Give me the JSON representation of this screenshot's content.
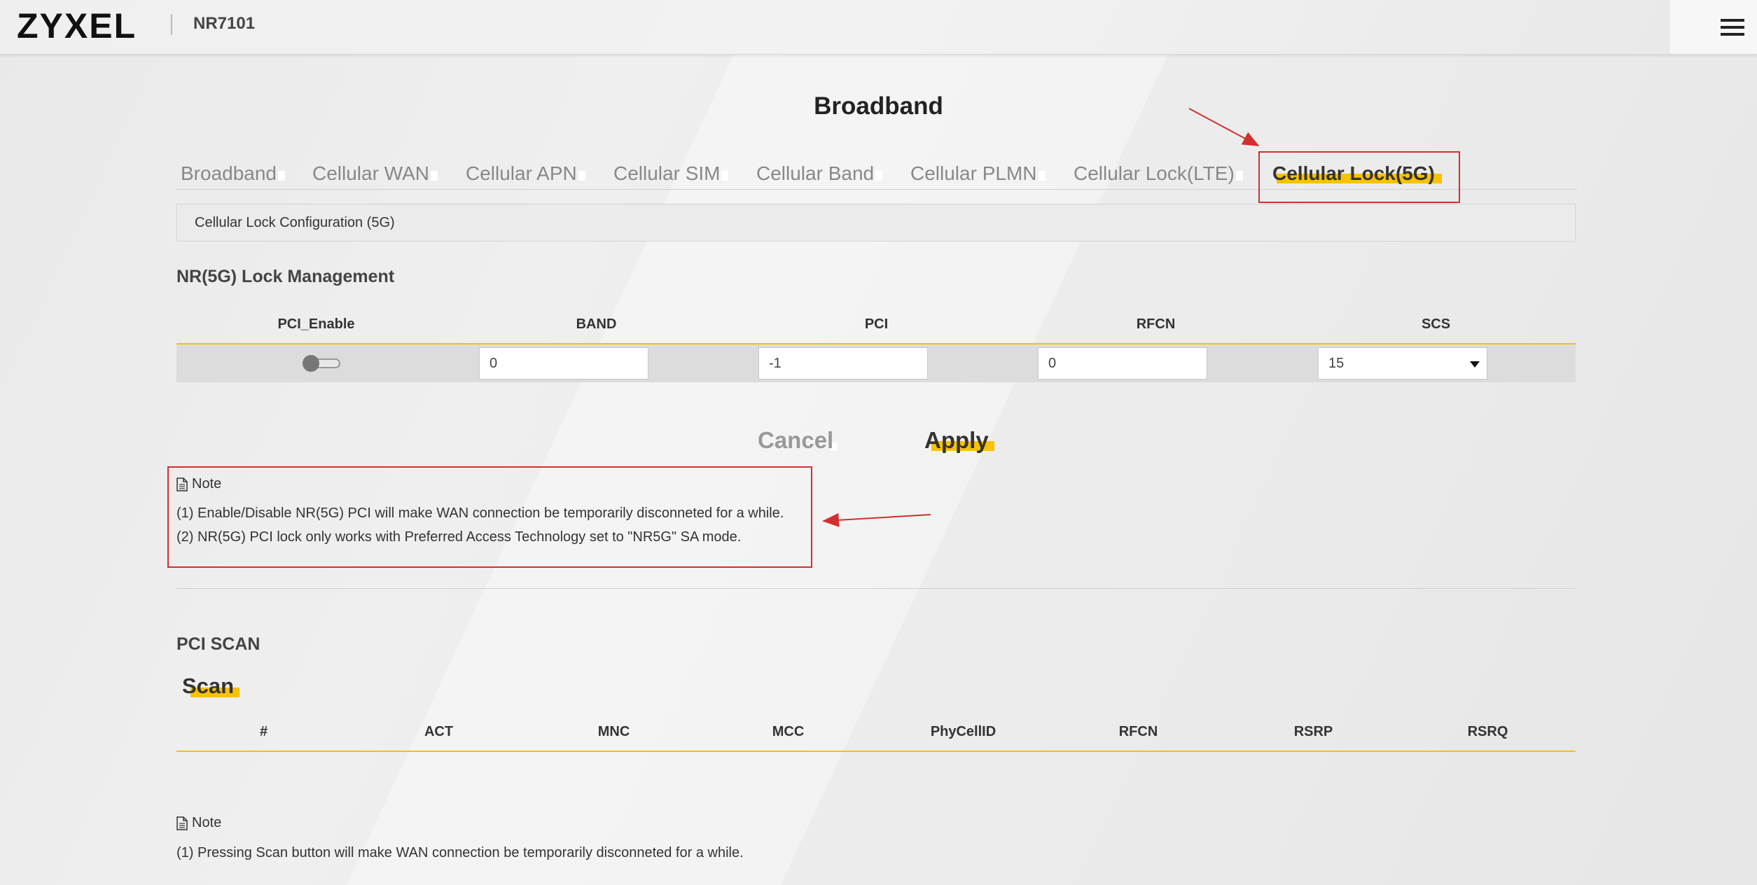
{
  "header": {
    "brand": "ZYXEL",
    "model": "NR7101"
  },
  "page_title": "Broadband",
  "tabs": [
    {
      "label": "Broadband",
      "active": false
    },
    {
      "label": "Cellular WAN",
      "active": false
    },
    {
      "label": "Cellular APN",
      "active": false
    },
    {
      "label": "Cellular SIM",
      "active": false
    },
    {
      "label": "Cellular Band",
      "active": false
    },
    {
      "label": "Cellular PLMN",
      "active": false
    },
    {
      "label": "Cellular Lock(LTE)",
      "active": false
    },
    {
      "label": "Cellular Lock(5G)",
      "active": true
    }
  ],
  "section_bar": "Cellular Lock Configuration (5G)",
  "lock_management": {
    "title": "NR(5G) Lock Management",
    "columns": [
      "PCI_Enable",
      "BAND",
      "PCI",
      "RFCN",
      "SCS"
    ],
    "row": {
      "pci_enable": false,
      "band": "0",
      "pci": "-1",
      "rfcn": "0",
      "scs": "15"
    }
  },
  "buttons": {
    "cancel": "Cancel",
    "apply": "Apply"
  },
  "note1": {
    "title": "Note",
    "lines": [
      "(1) Enable/Disable NR(5G) PCI will make WAN connection be temporarily disconneted for a while.",
      "(2) NR(5G) PCI lock only works with Preferred Access Technology set to \"NR5G\" SA mode."
    ]
  },
  "pci_scan": {
    "title": "PCI SCAN",
    "scan_label": "Scan",
    "columns": [
      "#",
      "ACT",
      "MNC",
      "MCC",
      "PhyCellID",
      "RFCN",
      "RSRP",
      "RSRQ"
    ]
  },
  "note2": {
    "title": "Note",
    "lines": [
      "(1) Pressing Scan button will make WAN connection be temporarily disconneted for a while."
    ]
  },
  "colors": {
    "accent": "#f7c200",
    "annotation_red": "#d32f2f"
  }
}
